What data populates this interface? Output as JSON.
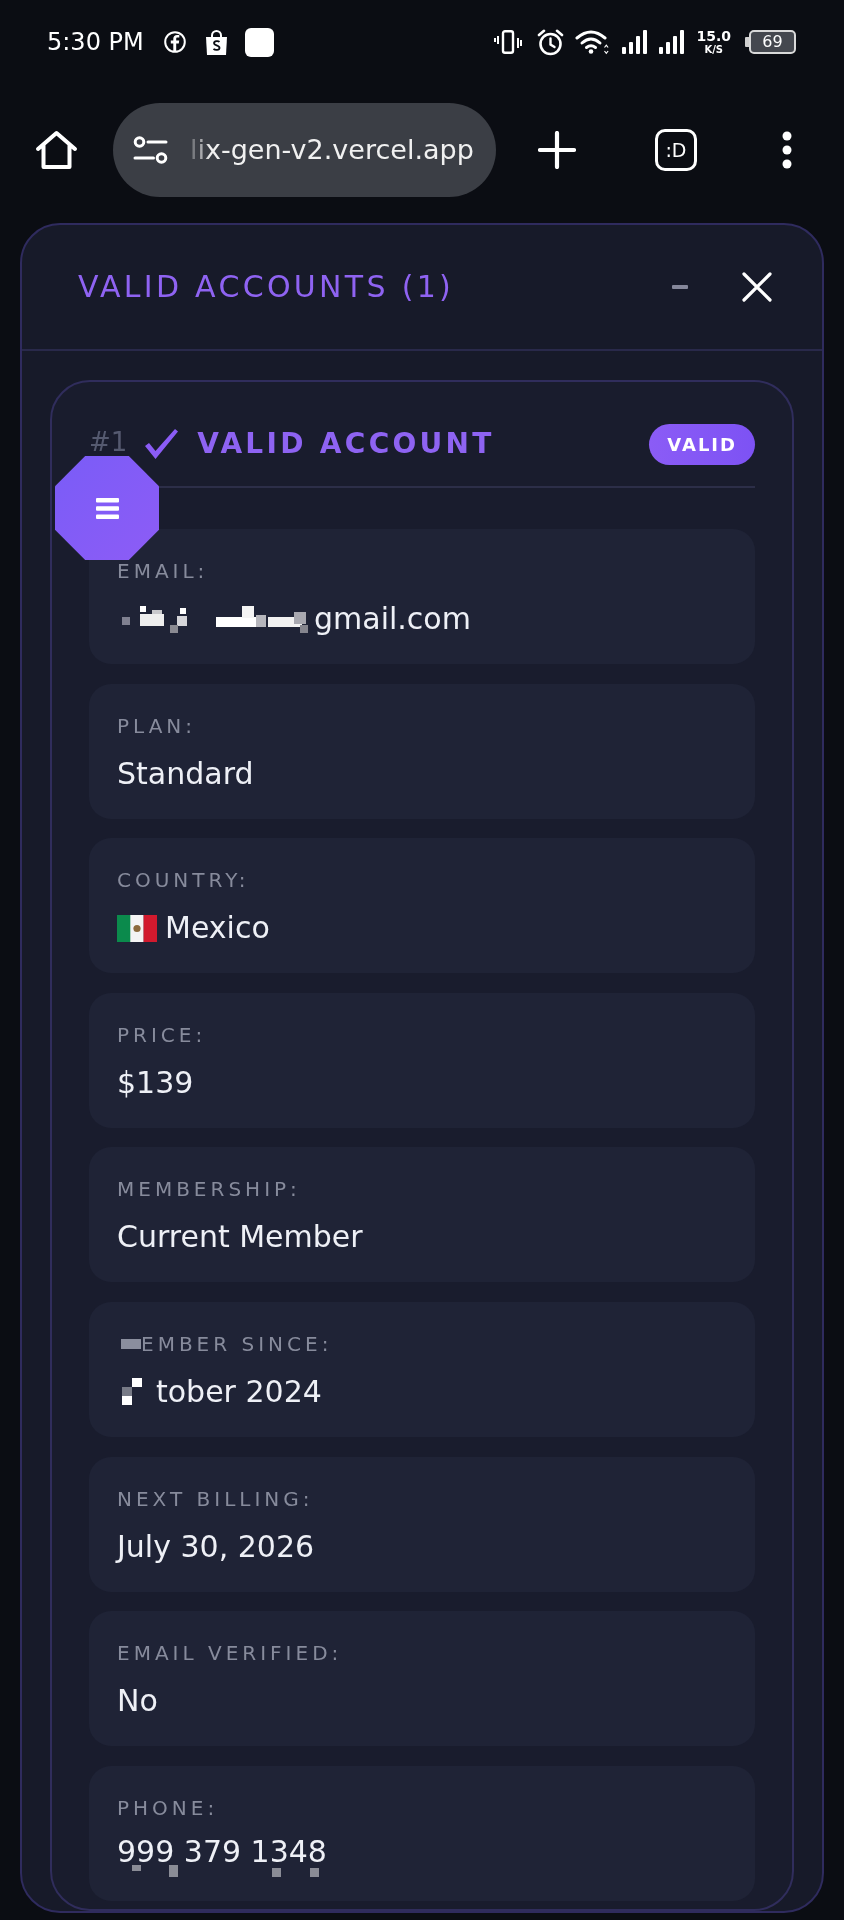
{
  "status_bar": {
    "time": "5:30 PM",
    "network_speed": "15.0",
    "network_speed_unit": "K/S",
    "battery": "69"
  },
  "browser_bar": {
    "url": "lix-gen-v2.vercel.app",
    "tab_switcher": ":D"
  },
  "panel": {
    "title": "VALID ACCOUNTS (1)",
    "accounts": [
      {
        "number": "#1",
        "title": "VALID ACCOUNT",
        "badge": "VALID",
        "fields": [
          {
            "kind": "plain",
            "label": "EMAIL:",
            "value": "gmail.com",
            "label_pixelated": false,
            "value_pixelated": true,
            "value_overlaid": false
          },
          {
            "kind": "plain",
            "label": "PLAN:",
            "value": "Standard",
            "label_pixelated": false,
            "value_pixelated": false,
            "value_overlaid": false
          },
          {
            "kind": "flag",
            "label": "COUNTRY:",
            "value": "Mexico",
            "label_pixelated": false,
            "value_pixelated": false,
            "value_overlaid": false
          },
          {
            "kind": "plain",
            "label": "PRICE:",
            "value": "$139",
            "label_pixelated": false,
            "value_pixelated": false,
            "value_overlaid": false
          },
          {
            "kind": "plain",
            "label": "MEMBERSHIP:",
            "value": "Current Member",
            "label_pixelated": false,
            "value_pixelated": false,
            "value_overlaid": false
          },
          {
            "kind": "plain",
            "label": "EMBER SINCE:",
            "value": "tober 2024",
            "label_pixelated": true,
            "value_pixelated": true,
            "value_overlaid": false
          },
          {
            "kind": "plain",
            "label": "NEXT BILLING:",
            "value": "July 30, 2026",
            "label_pixelated": false,
            "value_pixelated": false,
            "value_overlaid": false
          },
          {
            "kind": "plain",
            "label": "EMAIL VERIFIED:",
            "value": "No",
            "label_pixelated": false,
            "value_pixelated": false,
            "value_overlaid": false
          },
          {
            "kind": "plain",
            "label": "PHONE:",
            "value": "999 379 1348",
            "label_pixelated": false,
            "value_pixelated": false,
            "value_overlaid": true
          }
        ]
      }
    ]
  }
}
